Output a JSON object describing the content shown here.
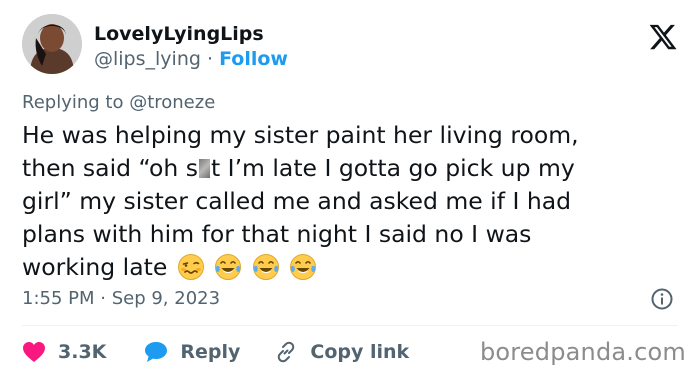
{
  "author": {
    "display_name": "LovelyLyingLips",
    "handle": "@lips_lying",
    "separator": "·",
    "follow_label": "Follow"
  },
  "reply_context": {
    "text": "Replying to @troneze"
  },
  "tweet": {
    "line1": "He was helping my sister paint her living room,",
    "line2_before": "then said “oh s",
    "line2_after": "t I’m late I gotta go pick up my",
    "line3": "girl” my sister called me and asked me if I had",
    "line4": "plans with him for that night I said no I was",
    "line5": "working late",
    "emojis": [
      "woozy-face",
      "face-with-tears-of-joy",
      "face-with-tears-of-joy",
      "face-with-tears-of-joy"
    ]
  },
  "timestamp": "1:55 PM · Sep 9, 2023",
  "actions": {
    "like_count": "3.3K",
    "reply_label": "Reply",
    "copy_link_label": "Copy link"
  },
  "watermark": "boredpanda.com",
  "colors": {
    "text": "#0f1419",
    "secondary": "#536471",
    "accent": "#1d9bf0",
    "like": "#f91880",
    "divider": "#eff3f4"
  },
  "icons": {
    "close": "x-logo-icon",
    "info": "info-icon",
    "like": "heart-icon",
    "reply": "speech-bubble-icon",
    "copy": "link-icon"
  }
}
